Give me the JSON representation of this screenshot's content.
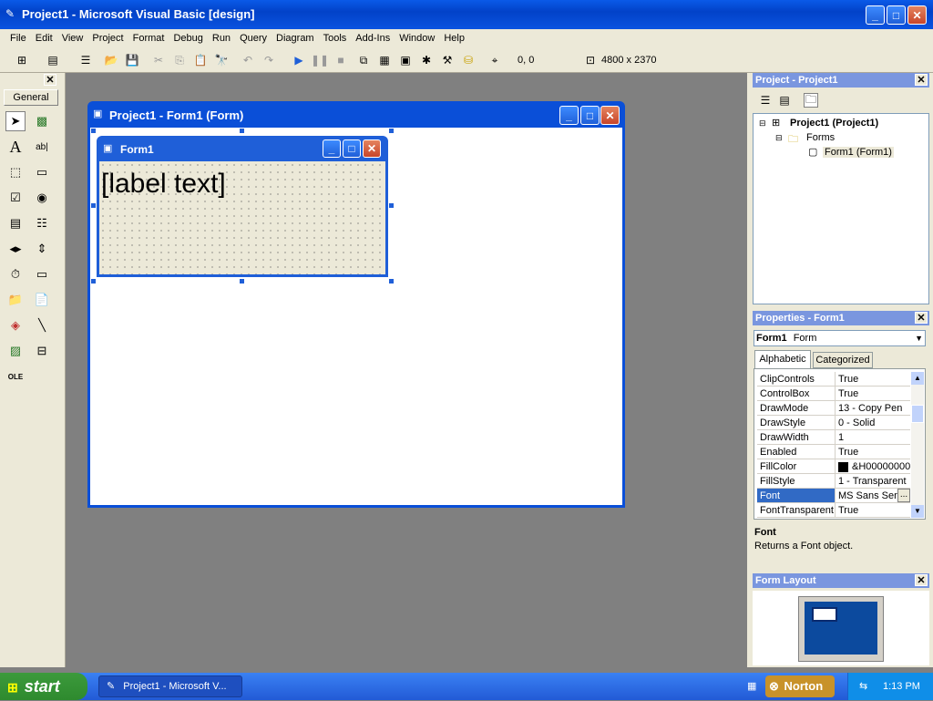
{
  "app": {
    "title": "Project1 - Microsoft Visual Basic [design]"
  },
  "menu": [
    "File",
    "Edit",
    "View",
    "Project",
    "Format",
    "Debug",
    "Run",
    "Query",
    "Diagram",
    "Tools",
    "Add-Ins",
    "Window",
    "Help"
  ],
  "toolbar": {
    "position": "0, 0",
    "size": "4800 x 2370"
  },
  "toolbox": {
    "title": "General"
  },
  "designer": {
    "title": "Project1 - Form1 (Form)"
  },
  "form": {
    "title": "Form1",
    "label_text": "[label text]"
  },
  "project": {
    "title": "Project - Project1",
    "root": "Project1 (Project1)",
    "folder": "Forms",
    "item": "Form1 (Form1)"
  },
  "properties": {
    "title": "Properties - Form1",
    "object": "Form1",
    "object_type": "Form",
    "tabs": [
      "Alphabetic",
      "Categorized"
    ],
    "rows": [
      {
        "k": "ClipControls",
        "v": "True"
      },
      {
        "k": "ControlBox",
        "v": "True"
      },
      {
        "k": "DrawMode",
        "v": "13 - Copy Pen"
      },
      {
        "k": "DrawStyle",
        "v": "0 - Solid"
      },
      {
        "k": "DrawWidth",
        "v": "1"
      },
      {
        "k": "Enabled",
        "v": "True"
      },
      {
        "k": "FillColor",
        "v": "&H00000000"
      },
      {
        "k": "FillStyle",
        "v": "1 - Transparent"
      },
      {
        "k": "Font",
        "v": "MS Sans Serif"
      },
      {
        "k": "FontTransparent",
        "v": "True"
      }
    ],
    "desc_title": "Font",
    "desc_text": "Returns a Font object."
  },
  "layout": {
    "title": "Form Layout"
  },
  "taskbar": {
    "start": "start",
    "task": "Project1 - Microsoft V...",
    "norton": "Norton",
    "clock": "1:13 PM"
  }
}
